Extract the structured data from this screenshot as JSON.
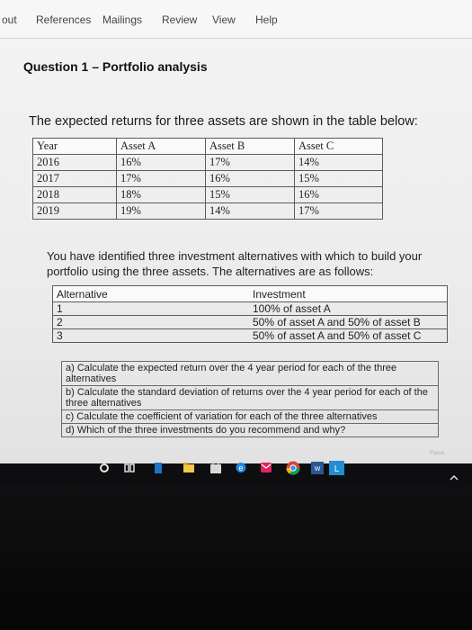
{
  "ribbon": {
    "tabs": [
      "out",
      "References",
      "Mailings",
      "Review",
      "View",
      "Help"
    ]
  },
  "document": {
    "title": "Question 1 – Portfolio analysis",
    "intro": "The expected returns for three assets are shown in the table below:",
    "returns_table": {
      "headers": [
        "Year",
        "Asset A",
        "Asset B",
        "Asset C"
      ],
      "rows": [
        [
          "2016",
          "16%",
          "17%",
          "14%"
        ],
        [
          "2017",
          "17%",
          "16%",
          "15%"
        ],
        [
          "2018",
          "18%",
          "15%",
          "16%"
        ],
        [
          "2019",
          "19%",
          "14%",
          "17%"
        ]
      ]
    },
    "alternatives_paragraph": "You have identified three investment alternatives with which to build your portfolio using the three assets. The alternatives are as follows:",
    "alternatives_table": {
      "headers": [
        "Alternative",
        "Investment"
      ],
      "rows": [
        [
          "1",
          "100% of asset A"
        ],
        [
          "2",
          "50% of asset A and 50% of asset B"
        ],
        [
          "3",
          "50% of asset A and 50% of asset C"
        ]
      ]
    },
    "questions": [
      "a) Calculate the expected return over the 4 year period for each of the three alternatives",
      "b) Calculate the standard deviation of returns over the 4 year period for each of the three alternatives",
      "c) Calculate the coefficient of variation for each of the three alternatives",
      "d) Which of the three investments do you recommend and why?"
    ]
  },
  "taskbar": {
    "status_text": "Focus",
    "icons": [
      "search-icon",
      "task-view-icon",
      "edge-icon",
      "file-explorer-icon",
      "store-icon",
      "chrome-icon",
      "mail-icon",
      "chrome-icon",
      "word-icon",
      "app-l-icon"
    ],
    "colors": {
      "word": "#2b5797",
      "app_l": "#1f8fd1",
      "mail": "#e0245e",
      "edge": "#1b74c9"
    }
  }
}
